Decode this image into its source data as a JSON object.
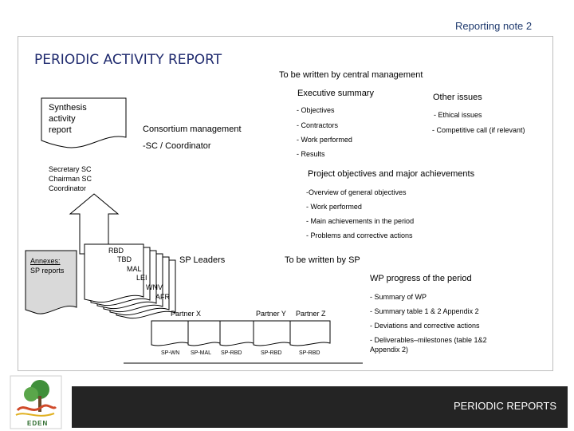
{
  "header": {
    "note": "Reporting note 2",
    "title": "PERIODIC ACTIVITY REPORT"
  },
  "top": {
    "written_by": "To be written by central management",
    "exec_summary": "Executive summary",
    "synthesis": [
      "Synthesis",
      "activity",
      "report"
    ],
    "consortium": "Consortium management",
    "sc_coordinator": "-SC / Coordinator",
    "exec_items": [
      "- Objectives",
      "- Contractors",
      "- Work performed",
      "- Results"
    ],
    "other_issues_title": "Other issues",
    "other_items": [
      "- Ethical issues",
      "- Competitive call (if relevant)"
    ],
    "signers": [
      "Secretary SC",
      "Chairman SC",
      "Coordinator"
    ]
  },
  "project": {
    "title": "Project objectives and major achievements",
    "items": [
      "-Overview of general objectives",
      "- Work performed",
      "- Main achievements in the period",
      "- Problems and corrective actions"
    ]
  },
  "sp": {
    "annexes": [
      "Annexes:",
      "SP reports"
    ],
    "stack_labels": [
      "RBD",
      "TBD",
      "MAL",
      "LEI",
      "WNV",
      "AFR"
    ],
    "leaders": "SP Leaders",
    "written_by_sp": "To be written by SP",
    "partners": [
      "Partner X",
      "Partner Y",
      "Partner Z"
    ],
    "doc_labels": [
      "SP-WN",
      "SP-MAL",
      "SP-RBD",
      "SP-RBD",
      "SP-RBD"
    ]
  },
  "wp": {
    "title": "WP progress of the period",
    "items": [
      "- Summary of WP",
      "- Summary table 1 & 2 Appendix 2",
      "- Deviations and corrective actions",
      "- Deliverables–milestones (table 1&2",
      "Appendix 2)"
    ]
  },
  "footer": {
    "label": "PERIODIC REPORTS",
    "logo_text": "EDEN"
  }
}
